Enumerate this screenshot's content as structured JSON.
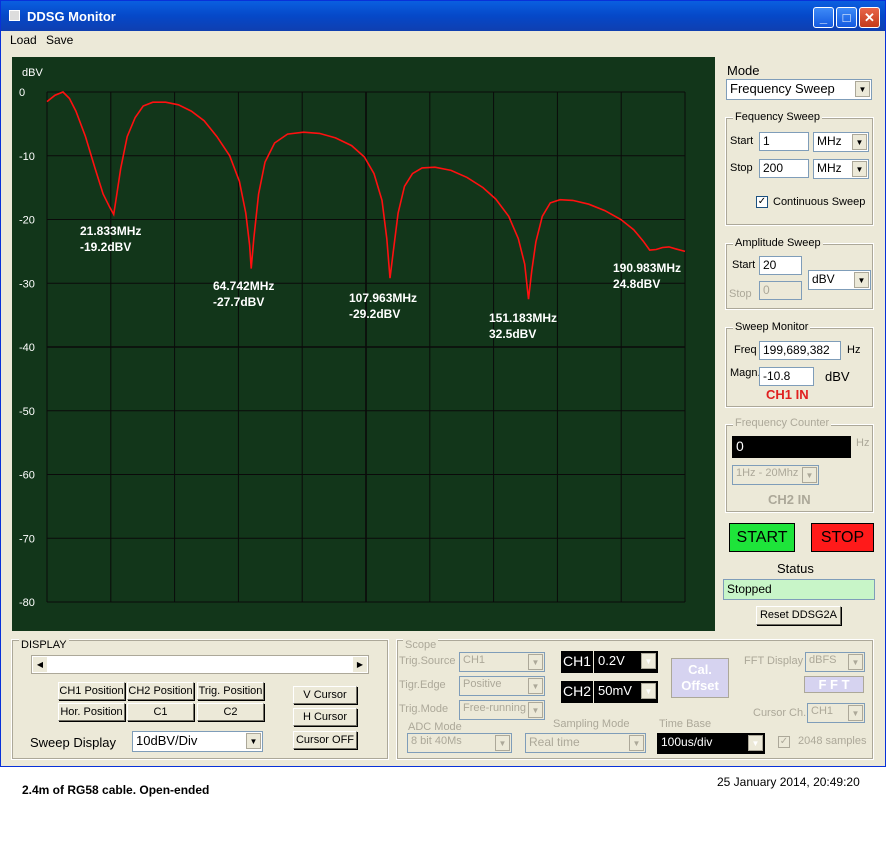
{
  "window": {
    "title": "DDSG Monitor",
    "minimize": "_",
    "maximize": "□",
    "close": "✕"
  },
  "menu": {
    "load": "Load",
    "save": "Save"
  },
  "plot": {
    "y_unit": "dBV",
    "y_ticks": [
      "0",
      "-10",
      "-20",
      "-30",
      "-40",
      "-50",
      "-60",
      "-70",
      "-80"
    ],
    "markers": [
      {
        "freq": "21.833MHz",
        "level": "-19.2dBV"
      },
      {
        "freq": "64.742MHz",
        "level": "-27.7dBV"
      },
      {
        "freq": "107.963MHz",
        "level": "-29.2dBV"
      },
      {
        "freq": "151.183MHz",
        "level": "32.5dBV"
      },
      {
        "freq": "190.983MHz",
        "level": "24.8dBV"
      }
    ],
    "trace_color": "#ff1010",
    "grid_color": "#0a0a0a",
    "trace_points": [
      [
        1,
        -1.5
      ],
      [
        3.5,
        -0.5
      ],
      [
        6,
        0
      ],
      [
        8,
        -1
      ],
      [
        10,
        -3
      ],
      [
        13,
        -7
      ],
      [
        16,
        -12
      ],
      [
        18.5,
        -16
      ],
      [
        20.5,
        -18
      ],
      [
        21.8,
        -19.2
      ],
      [
        22.5,
        -17
      ],
      [
        24,
        -12
      ],
      [
        26,
        -7
      ],
      [
        28.5,
        -4
      ],
      [
        31,
        -2.2
      ],
      [
        34,
        -1.6
      ],
      [
        38,
        -1.6
      ],
      [
        42,
        -2
      ],
      [
        46,
        -3
      ],
      [
        50,
        -4.5
      ],
      [
        54,
        -7
      ],
      [
        58,
        -10
      ],
      [
        61,
        -14
      ],
      [
        63,
        -19
      ],
      [
        64.2,
        -24
      ],
      [
        64.7,
        -27.7
      ],
      [
        65.5,
        -23
      ],
      [
        67,
        -16
      ],
      [
        69,
        -11
      ],
      [
        72,
        -8
      ],
      [
        76,
        -6.6
      ],
      [
        81,
        -6.3
      ],
      [
        86,
        -6.5
      ],
      [
        91,
        -7.2
      ],
      [
        96,
        -8.4
      ],
      [
        100,
        -10.2
      ],
      [
        103,
        -12.8
      ],
      [
        105.5,
        -17
      ],
      [
        107,
        -23
      ],
      [
        108,
        -29.2
      ],
      [
        109,
        -25
      ],
      [
        110.5,
        -19
      ],
      [
        112.5,
        -14.8
      ],
      [
        115,
        -12.8
      ],
      [
        118,
        -11.9
      ],
      [
        122,
        -11.8
      ],
      [
        127,
        -12.3
      ],
      [
        132,
        -13.4
      ],
      [
        137,
        -15
      ],
      [
        141,
        -16.8
      ],
      [
        145,
        -19.5
      ],
      [
        148,
        -23
      ],
      [
        150,
        -27
      ],
      [
        151.2,
        -32.5
      ],
      [
        152.2,
        -28
      ],
      [
        153.5,
        -23.5
      ],
      [
        155.5,
        -19.5
      ],
      [
        158,
        -17.4
      ],
      [
        161,
        -16.9
      ],
      [
        165,
        -17
      ],
      [
        170,
        -17.6
      ],
      [
        175,
        -18.6
      ],
      [
        180,
        -20
      ],
      [
        184,
        -21.6
      ],
      [
        187,
        -23.4
      ],
      [
        189,
        -24.8
      ],
      [
        191,
        -24.7
      ],
      [
        193,
        -24.4
      ],
      [
        195,
        -24.3
      ],
      [
        197,
        -24.6
      ],
      [
        200,
        -25
      ]
    ]
  },
  "mode": {
    "label": "Mode",
    "value": "Frequency Sweep"
  },
  "freq_sweep": {
    "title": "Fequency Sweep",
    "start_label": "Start",
    "start_value": "1",
    "start_unit": "MHz",
    "stop_label": "Stop",
    "stop_value": "200",
    "stop_unit": "MHz",
    "continuous_label": "Continuous Sweep",
    "continuous_checked": "✓"
  },
  "amp_sweep": {
    "title": "Amplitude Sweep",
    "start_label": "Start",
    "start_value": "20",
    "stop_label": "Stop",
    "stop_value": "0",
    "unit": "dBV"
  },
  "sweep_monitor": {
    "title": "Sweep Monitor",
    "freq_label": "Freq",
    "freq_value": "199,689,382",
    "freq_unit": "Hz",
    "magn_label": "Magn.",
    "magn_value": "-10.8",
    "magn_unit": "dBV",
    "channel": "CH1 IN"
  },
  "freq_counter": {
    "title": "Frequency Counter",
    "value": "0",
    "unit": "Hz",
    "range": "1Hz - 20Mhz",
    "channel": "CH2 IN"
  },
  "controls": {
    "start": "START",
    "stop": "STOP",
    "status_label": "Status",
    "status_value": "Stopped",
    "reset": "Reset DDSG2A"
  },
  "display": {
    "title": "DISPLAY",
    "ch1_pos": "CH1 Position",
    "ch2_pos": "CH2 Position",
    "trig_pos": "Trig. Position",
    "hor_pos": "Hor. Position",
    "c1": "C1",
    "c2": "C2",
    "v_cursor": "V Cursor",
    "h_cursor": "H Cursor",
    "cursor_off": "Cursor OFF",
    "sweep_display_label": "Sweep Display",
    "sweep_display_value": "10dBV/Div"
  },
  "scope": {
    "title": "Scope",
    "trig_source_label": "Trig.Source",
    "trig_source": "CH1",
    "trig_edge_label": "Tigr.Edge",
    "trig_edge": "Positive",
    "trig_mode_label": "Trig.Mode",
    "trig_mode": "Free-running",
    "ch1_label": "CH1",
    "ch1_value": "0.2V",
    "ch2_label": "CH2",
    "ch2_value": "50mV",
    "cal_offset": "Cal. Offset",
    "fft_display_label": "FFT Display",
    "fft_display": "dBFS",
    "fft_button": "F F T",
    "cursor_ch_label": "Cursor Ch.",
    "cursor_ch": "CH1",
    "adc_mode_label": "ADC Mode",
    "adc_mode": "8 bit 40Ms",
    "sampling_mode_label": "Sampling Mode",
    "sampling_mode": "Real time",
    "time_base_label": "Time Base",
    "time_base": "100us/div",
    "samples_label": "2048 samples"
  },
  "footer": {
    "caption": "2.4m  of RG58 cable. Open-ended",
    "timestamp": "25 January 2014, 20:49:20"
  }
}
